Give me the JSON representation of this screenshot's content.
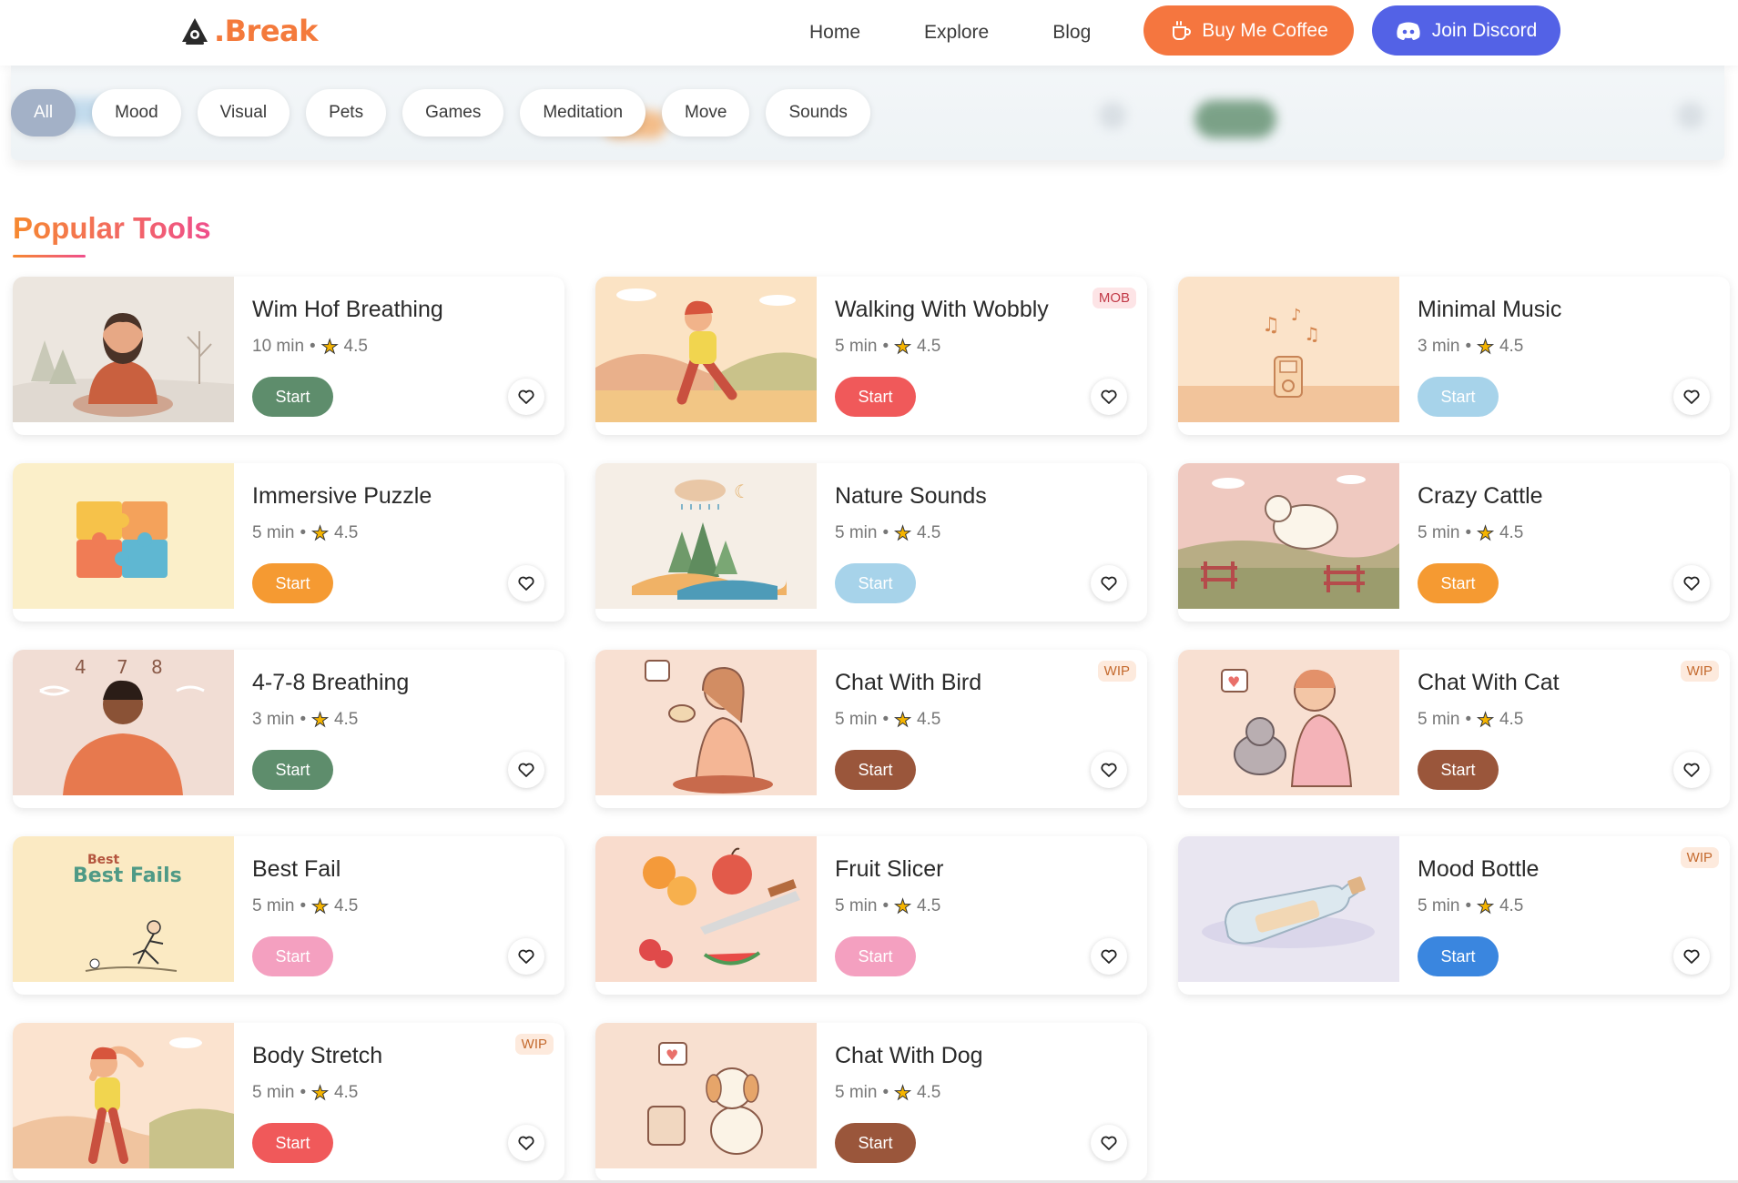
{
  "header": {
    "logo_text": ".Break",
    "nav": [
      "Home",
      "Explore",
      "Blog"
    ],
    "coffee_label": "Buy Me Coffee",
    "discord_label": "Join Discord"
  },
  "filters": [
    "All",
    "Mood",
    "Visual",
    "Pets",
    "Games",
    "Meditation",
    "Move",
    "Sounds"
  ],
  "active_filter": "All",
  "section_title": "Popular Tools",
  "colors": {
    "green": "#5e8d6c",
    "red": "#f0595a",
    "lightblue": "#a7d3ea",
    "orange": "#f59a32",
    "brown": "#9a563b",
    "pink": "#f4a0c0",
    "blue": "#3a86df"
  },
  "tools": [
    {
      "title": "Wim Hof Breathing",
      "duration": "10 min",
      "rating": "4.5",
      "start": "Start",
      "color": "green",
      "badge": "",
      "art": "man-meditate"
    },
    {
      "title": "Walking With Wobbly",
      "duration": "5 min",
      "rating": "4.5",
      "start": "Start",
      "color": "red",
      "badge": "MOB",
      "art": "walking-kid"
    },
    {
      "title": "Minimal Music",
      "duration": "3 min",
      "rating": "4.5",
      "start": "Start",
      "color": "lightblue",
      "badge": "",
      "art": "music-player"
    },
    {
      "title": "Immersive Puzzle",
      "duration": "5 min",
      "rating": "4.5",
      "start": "Start",
      "color": "orange",
      "badge": "",
      "art": "puzzle"
    },
    {
      "title": "Nature Sounds",
      "duration": "5 min",
      "rating": "4.5",
      "start": "Start",
      "color": "lightblue",
      "badge": "",
      "art": "nature"
    },
    {
      "title": "Crazy Cattle",
      "duration": "5 min",
      "rating": "4.5",
      "start": "Start",
      "color": "orange",
      "badge": "",
      "art": "sheep"
    },
    {
      "title": "4-7-8 Breathing",
      "duration": "3 min",
      "rating": "4.5",
      "start": "Start",
      "color": "green",
      "badge": "",
      "art": "breathing-478"
    },
    {
      "title": "Chat With Bird",
      "duration": "5 min",
      "rating": "4.5",
      "start": "Start",
      "color": "brown",
      "badge": "WIP",
      "art": "girl-bird"
    },
    {
      "title": "Chat With Cat",
      "duration": "5 min",
      "rating": "4.5",
      "start": "Start",
      "color": "brown",
      "badge": "WIP",
      "art": "boy-cat"
    },
    {
      "title": "Best Fail",
      "duration": "5 min",
      "rating": "4.5",
      "start": "Start",
      "color": "pink",
      "badge": "",
      "art": "best-fails"
    },
    {
      "title": "Fruit Slicer",
      "duration": "5 min",
      "rating": "4.5",
      "start": "Start",
      "color": "pink",
      "badge": "",
      "art": "fruits"
    },
    {
      "title": "Mood Bottle",
      "duration": "5 min",
      "rating": "4.5",
      "start": "Start",
      "color": "blue",
      "badge": "WIP",
      "art": "bottle"
    },
    {
      "title": "Body Stretch",
      "duration": "5 min",
      "rating": "4.5",
      "start": "Start",
      "color": "red",
      "badge": "WIP",
      "art": "stretch"
    },
    {
      "title": "Chat With Dog",
      "duration": "5 min",
      "rating": "4.5",
      "start": "Start",
      "color": "brown",
      "badge": "",
      "art": "dog"
    }
  ],
  "art_text": {
    "breathing_numbers": [
      "4",
      "7",
      "8"
    ],
    "best_fails_small": "Best",
    "best_fails_big": "Best Fails"
  }
}
